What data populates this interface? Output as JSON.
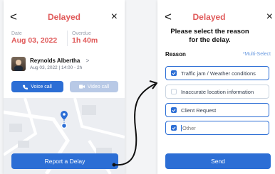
{
  "left": {
    "title": "Delayed",
    "back_glyph": "<",
    "close_glyph": "×",
    "date_label": "Date",
    "date_value": "Aug 03, 2022",
    "overdue_label": "Overdue",
    "overdue_value": "1h 40m",
    "contact_name": "Reynolds Albertha",
    "contact_arrow": ">",
    "contact_detail": "Aug 03, 2022 | 14:00 - 2h",
    "voice_call_label": "Voice call",
    "video_call_label": "Video call",
    "report_button_label": "Report a Delay"
  },
  "right": {
    "title": "Delayed",
    "back_glyph": "<",
    "close_glyph": "×",
    "heading_line1": "Please select the reason",
    "heading_line2": "for the delay.",
    "reason_label": "Reason",
    "multi_select_hint": "*Multi-Select",
    "options": [
      {
        "label": "Traffic jam / Weather conditions",
        "checked": true
      },
      {
        "label": "Inaccurate location information",
        "checked": false
      },
      {
        "label": "Client Request",
        "checked": true
      }
    ],
    "other_placeholder": "Other",
    "send_label": "Send"
  },
  "colors": {
    "accent_red": "#e05a5a",
    "primary_blue": "#2c6ed5",
    "disabled_blue": "#b8c9e6"
  }
}
